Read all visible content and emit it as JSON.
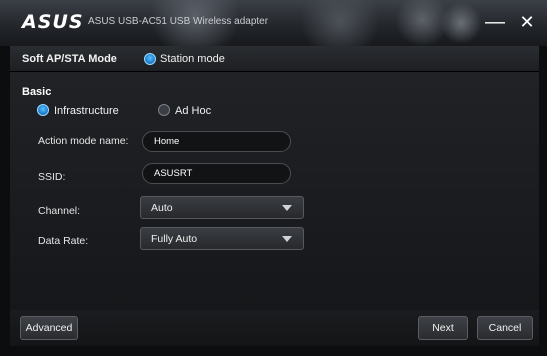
{
  "window": {
    "brand": "ASUS",
    "title": "ASUS USB-AC51 USB Wireless adapter",
    "minimize_symbol": "—",
    "close_symbol": "✕"
  },
  "mode_bar": {
    "title": "Soft AP/STA Mode",
    "station_mode_label": "Station mode",
    "station_mode_selected": true
  },
  "basic": {
    "heading": "Basic",
    "network_type": {
      "infrastructure_label": "Infrastructure",
      "adhoc_label": "Ad Hoc",
      "selected": "Infrastructure"
    },
    "action_mode_name": {
      "label": "Action mode name:",
      "value": "Home"
    },
    "ssid": {
      "label": "SSID:",
      "value": "ASUSRT"
    },
    "channel": {
      "label": "Channel:",
      "value": "Auto"
    },
    "data_rate": {
      "label": "Data Rate:",
      "value": "Fully Auto"
    }
  },
  "footer": {
    "advanced_label": "Advanced",
    "next_label": "Next",
    "cancel_label": "Cancel"
  },
  "colors": {
    "accent_radio": "#1e7fd0",
    "background": "#0c0d0f"
  }
}
